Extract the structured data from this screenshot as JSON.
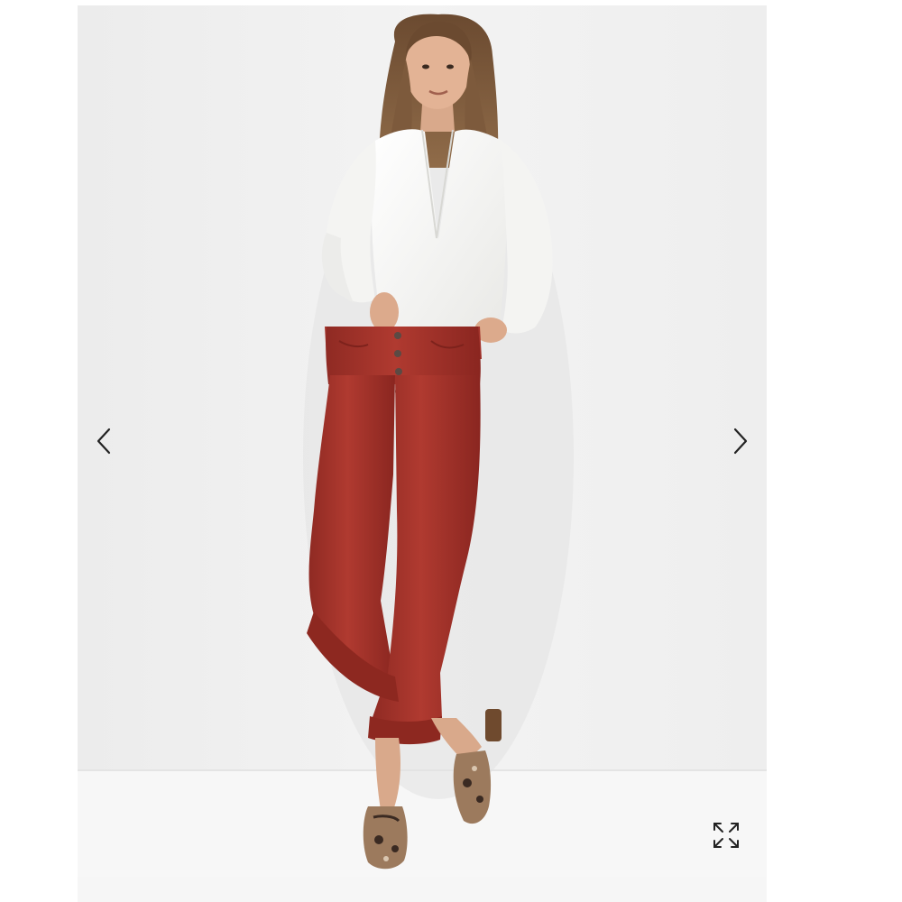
{
  "gallery": {
    "image_subject": "model-wearing-red-corduroy-flare-pants",
    "background_color": "#f1f1f1",
    "controls": {
      "prev_icon": "chevron-left-icon",
      "next_icon": "chevron-right-icon",
      "expand_icon": "expand-arrows-icon"
    }
  }
}
